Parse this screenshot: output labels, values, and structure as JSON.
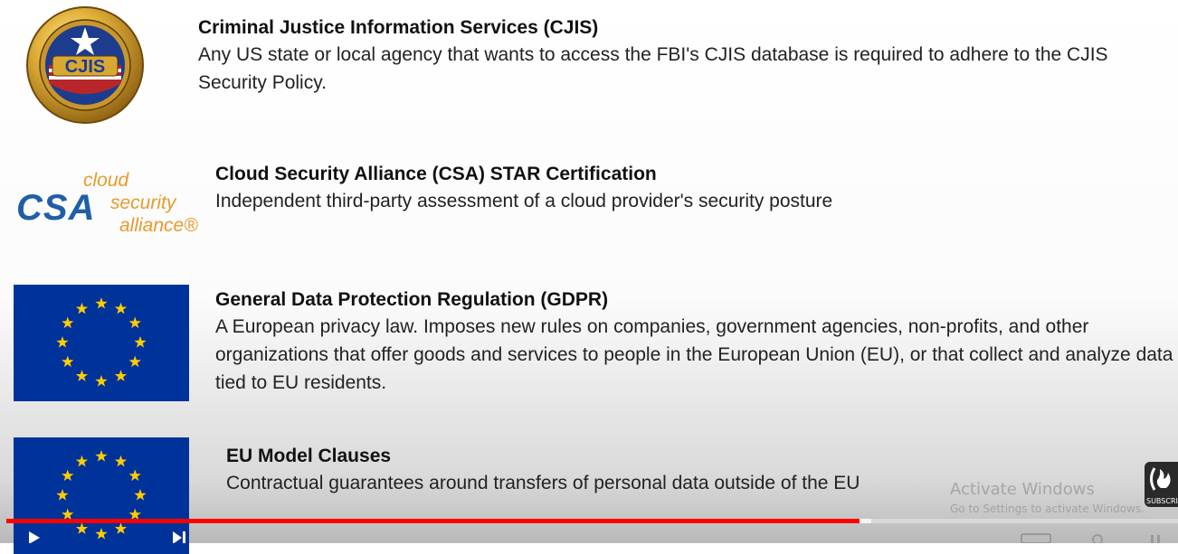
{
  "entries": [
    {
      "title": "Criminal Justice Information Services (CJIS)",
      "description": "Any US state or local agency that wants to access the FBI's CJIS database is required to adhere to the CJIS Security Policy.",
      "logo_text": "CJIS"
    },
    {
      "title": "Cloud Security Alliance (CSA) STAR Certification",
      "description": "Independent third-party assessment of a cloud provider's security posture",
      "logo_text": "CSA",
      "logo_words": [
        "cloud",
        "security",
        "alliance®"
      ]
    },
    {
      "title": "General Data Protection Regulation (GDPR)",
      "description": "A European privacy law. Imposes new rules on companies, government agencies, non-profits, and other organizations that offer goods and services to people in the European Union (EU), or that collect and analyze data tied to EU residents."
    },
    {
      "title": "EU Model Clauses",
      "description": "Contractual guarantees around transfers of personal data outside of the EU"
    }
  ],
  "watermark": {
    "title": "Activate Windows",
    "subtitle": "Go to Settings to activate Windows."
  },
  "subscribe": {
    "label": "SUBSCRIBE"
  },
  "player": {
    "progress_fraction": 0.728,
    "buffered_fraction": 0.738
  },
  "colors": {
    "progress": "#ff0000",
    "eu_blue": "#003399",
    "eu_star": "#ffcc00",
    "csa_blue": "#1f5fa8",
    "csa_orange": "#e89a2c"
  },
  "icons": {
    "play": "play-icon",
    "next": "next-icon",
    "subscribe": "subscribe-logo-icon"
  }
}
